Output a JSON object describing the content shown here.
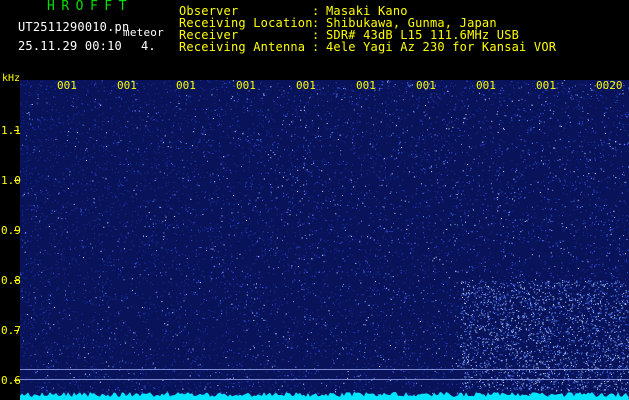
{
  "app": {
    "title": "HROFFT",
    "file_name": "UT2511290010.pn",
    "mode": "meteor",
    "datetime": "25.11.29 00:10",
    "count": "4."
  },
  "station": {
    "observer_label": "Observer",
    "observer_value": "Masaki Kano",
    "location_label": "Receiving Location",
    "location_value": "Shibukawa, Gunma, Japan",
    "receiver_label": "Receiver",
    "receiver_value": "SDR# 43dB L15 111.6MHz USB",
    "antenna_label": "Receiving Antenna",
    "antenna_value": "4ele Yagi Az 230 for Kansai VOR",
    "separator": ":"
  },
  "time_axis": {
    "ticks": [
      "001",
      "001",
      "001",
      "001",
      "001",
      "001",
      "001",
      "001",
      "001",
      "0020"
    ]
  },
  "freq_axis": {
    "unit": "kHz",
    "labels": [
      "1.1",
      "1.0",
      "0.9",
      "0.8",
      "0.7",
      "0.6"
    ]
  },
  "colors": {
    "background": "#000000",
    "plot_bg": "#08135a",
    "label": "#ffff00",
    "title": "#00e000",
    "signal": "#00e5ff"
  }
}
